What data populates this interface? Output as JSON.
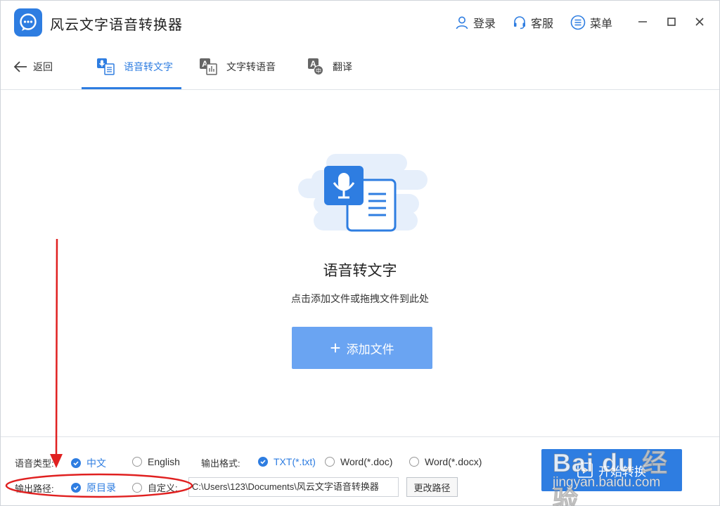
{
  "app": {
    "title": "风云文字语音转换器",
    "header_buttons": [
      {
        "label": "登录",
        "icon": "user-icon"
      },
      {
        "label": "客服",
        "icon": "headset-icon"
      },
      {
        "label": "菜单",
        "icon": "menu-icon"
      }
    ],
    "window_controls": [
      "minimize-icon",
      "maximize-icon",
      "close-icon"
    ]
  },
  "nav": {
    "back_label": "返回",
    "tabs": [
      {
        "label": "语音转文字",
        "icon": "voice-to-text-icon",
        "active": true
      },
      {
        "label": "文字转语音",
        "icon": "text-to-voice-icon",
        "active": false
      },
      {
        "label": "翻译",
        "icon": "translate-icon",
        "active": false
      }
    ]
  },
  "main": {
    "title": "语音转文字",
    "subtitle": "点击添加文件或拖拽文件到此处",
    "add_button": "添加文件"
  },
  "settings": {
    "voice_type_label": "语音类型:",
    "voice_types": [
      {
        "label": "中文",
        "checked": true
      },
      {
        "label": "English",
        "checked": false
      }
    ],
    "output_format_label": "输出格式:",
    "output_formats": [
      {
        "label": "TXT(*.txt)",
        "checked": true
      },
      {
        "label": "Word(*.doc)",
        "checked": false
      },
      {
        "label": "Word(*.docx)",
        "checked": false
      }
    ],
    "output_path_label": "输出路径:",
    "output_paths": [
      {
        "label": "原目录",
        "checked": true
      },
      {
        "label": "自定义:",
        "checked": false
      }
    ],
    "path_value": "C:\\Users\\123\\Documents\\风云文字语音转换器",
    "change_path_button": "更改路径",
    "start_button": "开始转换"
  },
  "watermark": {
    "main": "Bai du 经验",
    "sub": "jingyan.baidu.com"
  },
  "colors": {
    "accent": "#2e7de1",
    "add_button": "#6aa4f2",
    "annotation": "#e02020"
  }
}
